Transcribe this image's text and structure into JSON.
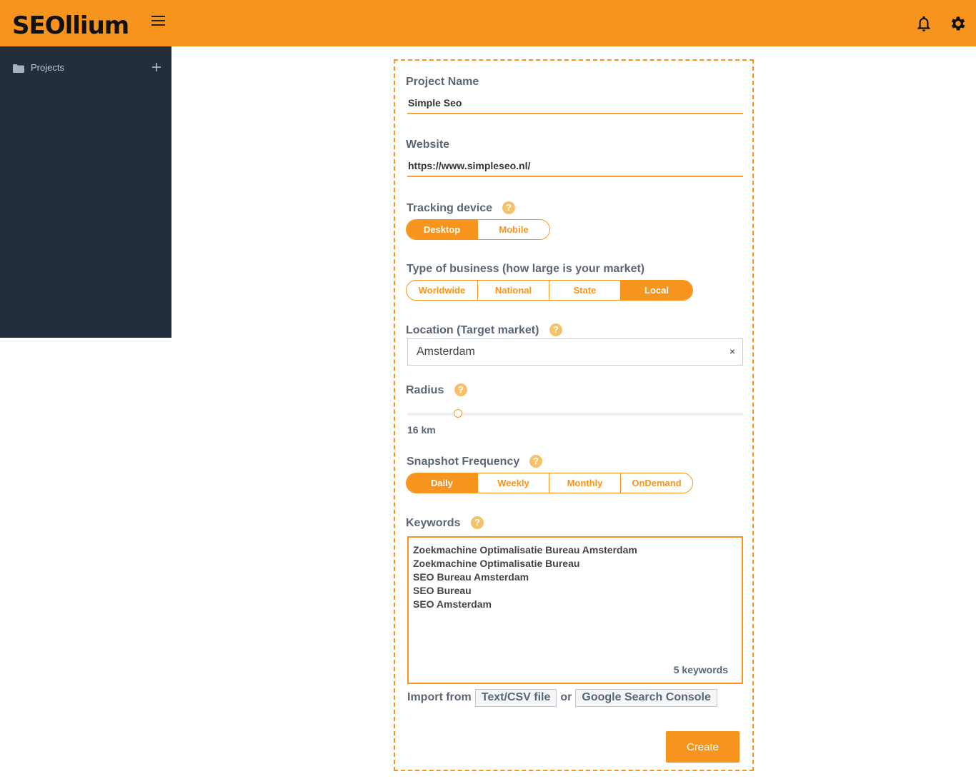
{
  "header": {
    "brand": "SEOllium",
    "menu_icon": "hamburger-icon",
    "notifications_icon": "bell-icon",
    "settings_icon": "gear-icon",
    "bg_color": "#f7941d"
  },
  "sidebar": {
    "bg_color": "#222e3c",
    "items": [
      {
        "label": "Projects",
        "icon": "folder-icon",
        "action_icon": "plus-icon"
      }
    ]
  },
  "form": {
    "project_name": {
      "label": "Project Name",
      "value": "Simple Seo"
    },
    "website": {
      "label": "Website",
      "value": "https://www.simpleseo.nl/"
    },
    "tracking_device": {
      "label": "Tracking device",
      "options": [
        "Desktop",
        "Mobile"
      ],
      "selected": "Desktop"
    },
    "business_type": {
      "label": "Type of business (how large is your market)",
      "options": [
        "Worldwide",
        "National",
        "State",
        "Local"
      ],
      "selected": "Local"
    },
    "location": {
      "label": "Location (Target market)",
      "value": "Amsterdam",
      "clear_symbol": "×"
    },
    "radius": {
      "label": "Radius",
      "value_text": "16 km",
      "fraction": 0.15
    },
    "snapshot_frequency": {
      "label": "Snapshot Frequency",
      "options": [
        "Daily",
        "Weekly",
        "Monthly",
        "OnDemand"
      ],
      "selected": "Daily"
    },
    "keywords": {
      "label": "Keywords",
      "items": [
        "Zoekmachine Optimalisatie Bureau Amsterdam",
        "Zoekmachine Optimalisatie Bureau",
        "SEO Bureau Amsterdam",
        "SEO Bureau",
        "SEO Amsterdam"
      ],
      "count_text": "5 keywords"
    },
    "import": {
      "prefix": "Import from",
      "file_button": "Text/CSV file",
      "separator": "or",
      "gsc_button": "Google Search Console"
    },
    "create_button": "Create",
    "help_symbol": "?",
    "accent_color": "#f7941d"
  }
}
